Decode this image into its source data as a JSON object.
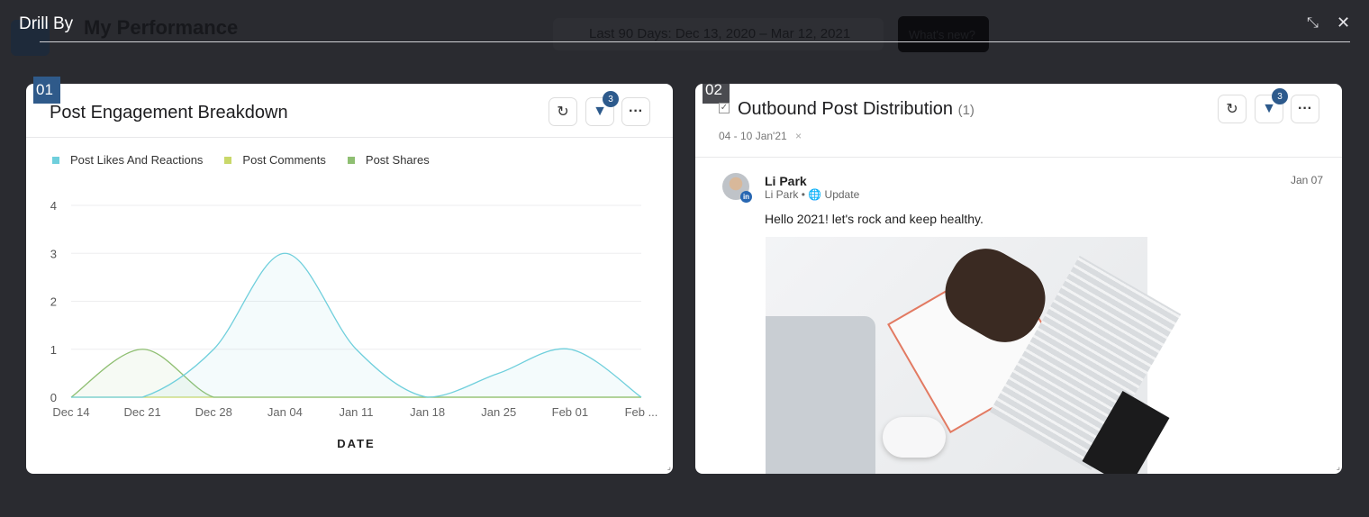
{
  "overlay": {
    "title": "Drill By",
    "minimize_icon": "collapse-icon",
    "close_icon": "close-icon"
  },
  "background": {
    "title": "My Performance",
    "date_range": "Last 90 Days: Dec 13, 2020 – Mar 12, 2021",
    "whats_new": "What's new?"
  },
  "panels": [
    {
      "number": "01",
      "title": "Post Engagement Breakdown",
      "filter_count": "3"
    },
    {
      "number": "02",
      "title": "Outbound Post Distribution",
      "count": "(1)",
      "filter_chip": "04 - 10 Jan'21",
      "filter_count": "3",
      "post": {
        "author": "Li Park",
        "sub_author": "Li Park",
        "separator": "•",
        "type": "Update",
        "date": "Jan 07",
        "text": "Hello 2021! let's rock and keep healthy.",
        "network": "linkedin"
      }
    }
  ],
  "chart_data": {
    "type": "area",
    "categories": [
      "Dec 14",
      "Dec 21",
      "Dec 28",
      "Jan 04",
      "Jan 11",
      "Jan 18",
      "Jan 25",
      "Feb 01",
      "Feb ..."
    ],
    "series": [
      {
        "name": "Post Likes And Reactions",
        "color": "#6fcfdc",
        "values": [
          0,
          0,
          1,
          3,
          1,
          0,
          0.5,
          1,
          0
        ]
      },
      {
        "name": "Post Comments",
        "color": "#c9d86a",
        "values": [
          0,
          0,
          0,
          0,
          0,
          0,
          0,
          0,
          0
        ]
      },
      {
        "name": "Post Shares",
        "color": "#8fbf72",
        "values": [
          0,
          1,
          0,
          0,
          0,
          0,
          0,
          0,
          0
        ]
      }
    ],
    "yticks": [
      "0",
      "1",
      "2",
      "3",
      "4"
    ],
    "ylim": [
      0,
      4
    ],
    "xlabel": "DATE",
    "grid": true,
    "legend": "top-left"
  }
}
